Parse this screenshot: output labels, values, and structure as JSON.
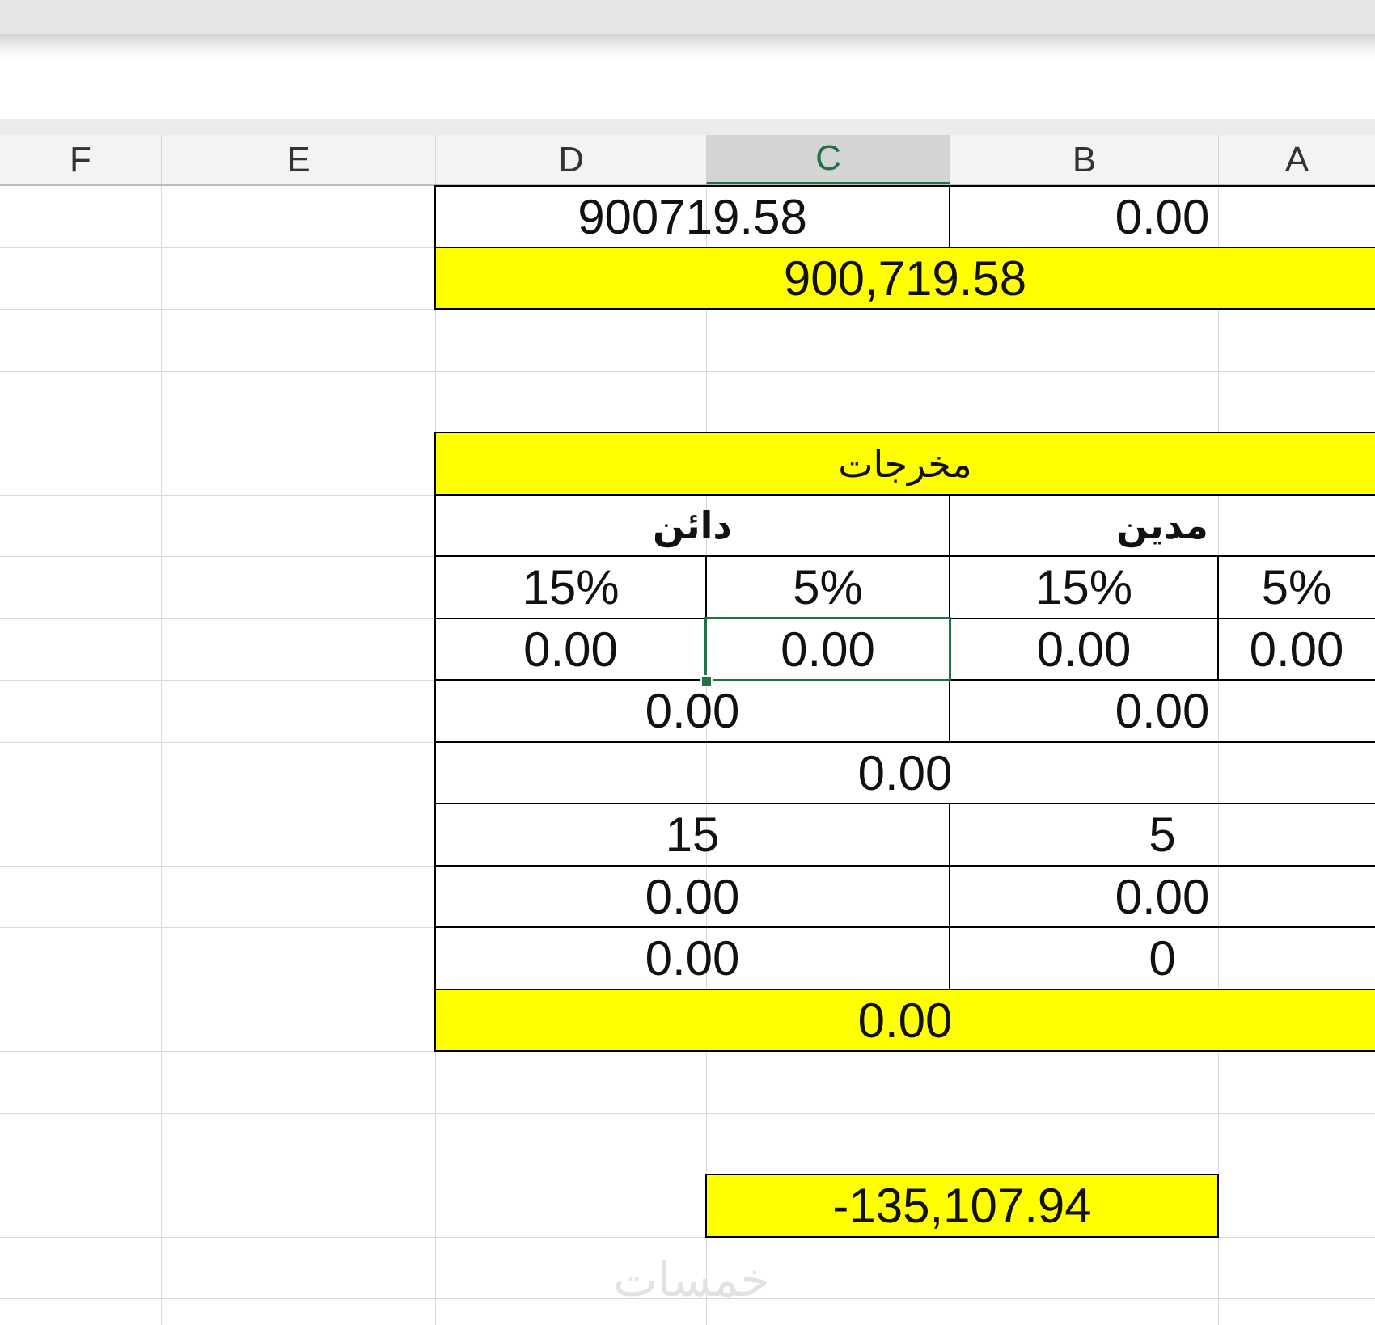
{
  "columns": [
    "F",
    "E",
    "D",
    "C",
    "B",
    "A"
  ],
  "selected_column": "C",
  "row1": {
    "cd_value": "900719.58",
    "ab_value": "0.00"
  },
  "row2": {
    "total": "900,719.58"
  },
  "outputs_table": {
    "title": "مخرجات",
    "creditor_label": "دائن",
    "debtor_label": "مدين",
    "rate_d": "15%",
    "rate_c": "5%",
    "rate_b": "15%",
    "rate_a": "5%",
    "val_d": "0.00",
    "val_c": "0.00",
    "val_b": "0.00",
    "val_a": "0.00",
    "creditor_subtotal": "0.00",
    "debtor_subtotal": "0.00",
    "combined_total": "0.00",
    "creditor_rate_number": "15",
    "debtor_rate_number": "5",
    "creditor_calc1": "0.00",
    "debtor_calc1": "0.00",
    "creditor_calc2": "0.00",
    "debtor_calc2": "0",
    "final_total": "0.00"
  },
  "result_cell": "-135,107.94",
  "watermark": "خمسات",
  "colors": {
    "highlight": "#ffff00",
    "selection": "#217346"
  }
}
